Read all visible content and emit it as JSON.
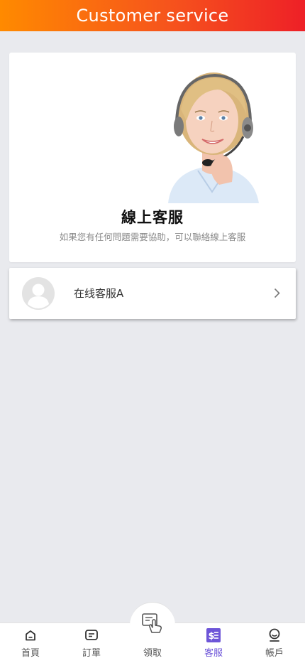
{
  "header": {
    "title": "Customer service"
  },
  "hero": {
    "title": "線上客服",
    "subtitle": "如果您有任何問題需要協助，可以聯絡線上客服"
  },
  "service_list": [
    {
      "name": "在线客服A"
    }
  ],
  "tabbar": {
    "active_tab": "客服",
    "accent_color": "#6d55d8",
    "tabs": [
      {
        "label": "首頁",
        "icon": "home-icon"
      },
      {
        "label": "訂單",
        "icon": "orders-icon"
      },
      {
        "label": "領取",
        "icon": "tap-claim-icon"
      },
      {
        "label": "客服",
        "icon": "customer-service-icon"
      },
      {
        "label": "帳戶",
        "icon": "account-icon"
      }
    ]
  },
  "colors": {
    "header_gradient_start": "#ff8a00",
    "header_gradient_end": "#ee2027",
    "page_background": "#e9eaee"
  }
}
